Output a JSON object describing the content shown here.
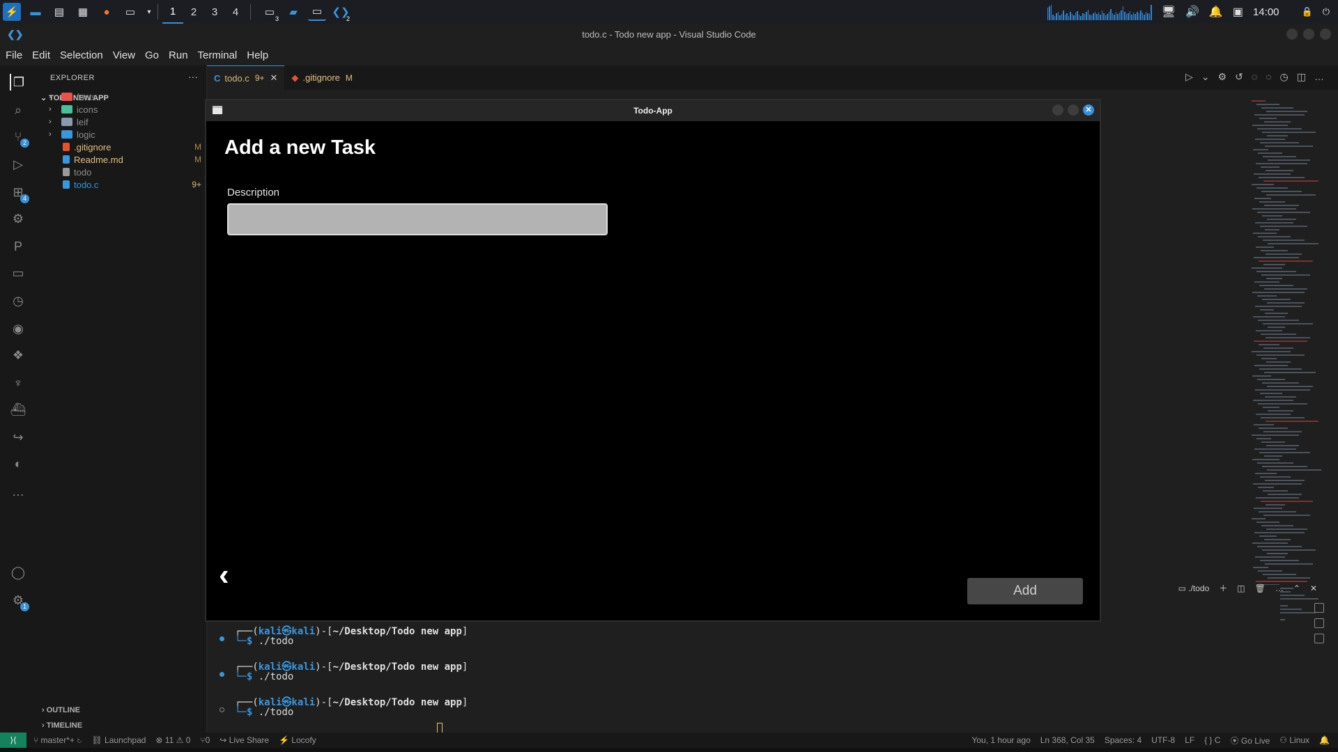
{
  "taskbar": {
    "workspaces": [
      "1",
      "2",
      "3",
      "4"
    ],
    "active_workspace": "1",
    "terminal_badge": "3",
    "vscode_badge": "2",
    "clock": "14:00"
  },
  "window": {
    "title": "todo.c - Todo new app - Visual Studio Code"
  },
  "menu": [
    "File",
    "Edit",
    "Selection",
    "View",
    "Go",
    "Run",
    "Terminal",
    "Help"
  ],
  "activity_bar": {
    "source_control_badge": "2",
    "extensions_badge": "4",
    "settings_badge": "1"
  },
  "sidebar": {
    "title": "EXPLORER",
    "more": "···",
    "section": "TODO NEW APP",
    "tree": [
      {
        "name": "fonts",
        "type": "folder",
        "color": "#e8524a",
        "badge": ""
      },
      {
        "name": "icons",
        "type": "folder",
        "color": "#4bbf9b",
        "badge": ""
      },
      {
        "name": "leif",
        "type": "folder",
        "color": "#8a9bb0",
        "badge": ""
      },
      {
        "name": "logic",
        "type": "folder",
        "color": "#3a96dd",
        "badge": ""
      },
      {
        "name": ".gitignore",
        "type": "file",
        "color": "#e5532c",
        "badge": "M"
      },
      {
        "name": "Readme.md",
        "type": "file",
        "color": "#3a96dd",
        "badge": "M"
      },
      {
        "name": "todo",
        "type": "file",
        "color": "#9a9a9a",
        "badge": ""
      },
      {
        "name": "todo.c",
        "type": "file",
        "color": "#3a96dd",
        "badge": "9+"
      }
    ],
    "outline": "OUTLINE",
    "timeline": "TIMELINE"
  },
  "tabs": [
    {
      "label": "todo.c",
      "status": "9+",
      "active": true
    },
    {
      "label": ".gitignore",
      "status": "M",
      "active": false
    }
  ],
  "app": {
    "title": "Todo-App",
    "heading": "Add a new Task",
    "description_label": "Description",
    "description_value": "",
    "back_glyph": "‹",
    "add_label": "Add"
  },
  "terminal": {
    "panel_label": "./todo",
    "sessions": [
      {
        "prompt_user": "kali㉿kali",
        "prompt_path": "~/Desktop/Todo new app",
        "command": "./todo"
      },
      {
        "prompt_user": "kali㉿kali",
        "prompt_path": "~/Desktop/Todo new app",
        "command": "./todo"
      },
      {
        "prompt_user": "kali㉿kali",
        "prompt_path": "~/Desktop/Todo new app",
        "command": "./todo"
      }
    ]
  },
  "statusbar": {
    "branch": "master*+",
    "launchpad": "Launchpad",
    "problems": "⊗ 11 ⚠ 0",
    "ports": "⑂0",
    "live_share": "Live Share",
    "locofy": "Locofy",
    "blame": "You, 1 hour ago",
    "position": "Ln 368, Col 35",
    "spaces": "Spaces: 4",
    "encoding": "UTF-8",
    "eol": "LF",
    "language": "{ } C",
    "go_live": "Go Live",
    "os": "Linux"
  }
}
